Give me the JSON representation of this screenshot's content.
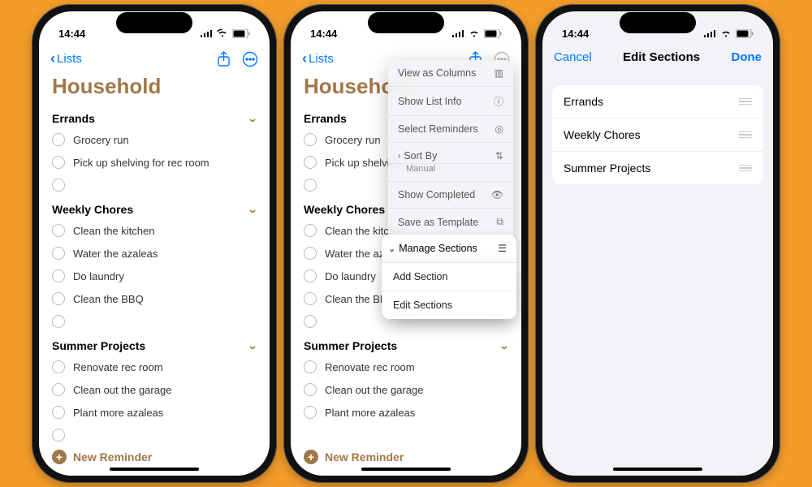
{
  "status": {
    "time": "14:44"
  },
  "colors": {
    "accent": "#A37849",
    "ios_blue": "#007AFF"
  },
  "nav": {
    "back_label": "Lists",
    "share_icon": "share-icon",
    "more_icon": "ellipsis-circle-icon"
  },
  "list": {
    "title": "Household",
    "sections": [
      {
        "name": "Errands",
        "items": [
          "Grocery run",
          "Pick up shelving for rec room"
        ]
      },
      {
        "name": "Weekly Chores",
        "items": [
          "Clean the kitchen",
          "Water the azaleas",
          "Do laundry",
          "Clean the BBQ"
        ]
      },
      {
        "name": "Summer Projects",
        "items": [
          "Renovate rec room",
          "Clean out the garage",
          "Plant more azaleas"
        ]
      }
    ],
    "new_reminder_label": "New Reminder"
  },
  "phone2_list": {
    "sections": [
      {
        "name": "Errands",
        "items": [
          "Grocery run",
          "Pick up shelving"
        ]
      },
      {
        "name": "Weekly Chores",
        "items": [
          "Clean the kitche",
          "Water the azale",
          "Do laundry",
          "Clean the BBQ"
        ]
      },
      {
        "name": "Summer Projects",
        "items": [
          "Renovate rec room",
          "Clean out the garage",
          "Plant more azaleas"
        ]
      }
    ]
  },
  "menu": {
    "items": [
      {
        "label": "View as Columns",
        "icon": "columns-icon"
      },
      {
        "label": "Show List Info",
        "icon": "info-icon"
      },
      {
        "label": "Select Reminders",
        "icon": "select-icon"
      },
      {
        "label": "Sort By",
        "sublabel": "Manual",
        "icon": "sort-icon"
      },
      {
        "label": "Show Completed",
        "icon": "eye-icon"
      },
      {
        "label": "Save as Template",
        "icon": "template-icon"
      }
    ],
    "active": {
      "label": "Manage Sections",
      "icon": "sections-icon"
    },
    "submenu": [
      {
        "label": "Add Section"
      },
      {
        "label": "Edit Sections"
      }
    ]
  },
  "edit": {
    "cancel_label": "Cancel",
    "title": "Edit Sections",
    "done_label": "Done",
    "rows": [
      "Errands",
      "Weekly Chores",
      "Summer Projects"
    ]
  }
}
